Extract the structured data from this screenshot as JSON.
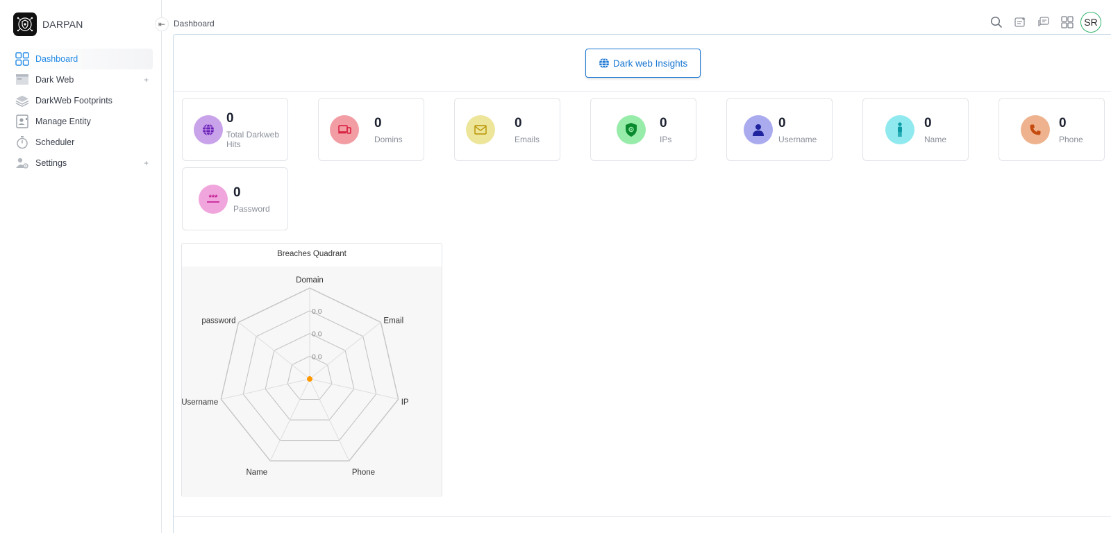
{
  "brand": {
    "name": "DARPAN"
  },
  "sidebar": {
    "items": [
      {
        "label": "Dashboard",
        "icon": "dashboard-grid-icon",
        "active": true,
        "expandable": false
      },
      {
        "label": "Dark Web",
        "icon": "browser-window-icon",
        "active": false,
        "expandable": true
      },
      {
        "label": "DarkWeb Footprints",
        "icon": "layers-icon",
        "active": false,
        "expandable": false
      },
      {
        "label": "Manage Entity",
        "icon": "contact-card-icon",
        "active": false,
        "expandable": false
      },
      {
        "label": "Scheduler",
        "icon": "stopwatch-icon",
        "active": false,
        "expandable": false
      },
      {
        "label": "Settings",
        "icon": "user-gear-icon",
        "active": false,
        "expandable": true
      }
    ],
    "expand_symbol": "+",
    "collapse_symbol": "⇤"
  },
  "header": {
    "breadcrumb": "Dashboard",
    "icons": [
      "search-icon",
      "notes-icon",
      "chat-icon",
      "apps-grid-icon"
    ],
    "avatar_initials": "SR"
  },
  "insights": {
    "button_label": "Dark web Insights"
  },
  "stats": [
    {
      "value": "0",
      "label": "Total Darkweb Hits",
      "icon": "globe-icon",
      "color": "#c9a3ea",
      "icon_color": "#6a1fb8"
    },
    {
      "value": "0",
      "label": "Domins",
      "icon": "devices-icon",
      "color": "#f29ca4",
      "icon_color": "#d81b3c"
    },
    {
      "value": "0",
      "label": "Emails",
      "icon": "envelope-icon",
      "color": "#ede59a",
      "icon_color": "#b89200"
    },
    {
      "value": "0",
      "label": "IPs",
      "icon": "shield-gear-icon",
      "color": "#98ecaa",
      "icon_color": "#0a8a2e"
    },
    {
      "value": "0",
      "label": "Username",
      "icon": "person-icon",
      "color": "#a9abee",
      "icon_color": "#1f239e"
    },
    {
      "value": "0",
      "label": "Name",
      "icon": "standing-person-icon",
      "color": "#8fe9ee",
      "icon_color": "#0a9aa4"
    },
    {
      "value": "0",
      "label": "Phone",
      "icon": "phone-icon",
      "color": "#eeb38e",
      "icon_color": "#c44a0e"
    },
    {
      "value": "0",
      "label": "Password",
      "icon": "password-dots-icon",
      "color": "#f0a6dc",
      "icon_color": "#c2128f"
    }
  ],
  "chart_data": {
    "type": "radar",
    "title": "Breaches Quadrant",
    "axes": [
      "Domain",
      "Email",
      "IP",
      "Phone",
      "Name",
      "Username",
      "password"
    ],
    "series": [
      {
        "values": [
          0,
          0,
          0,
          0,
          0,
          0,
          0
        ]
      }
    ],
    "tick_labels": [
      "0.0",
      "0.0",
      "0.0"
    ],
    "rings": 4,
    "point_color": "#ff9800",
    "grid_color": "#c4c4c4"
  }
}
